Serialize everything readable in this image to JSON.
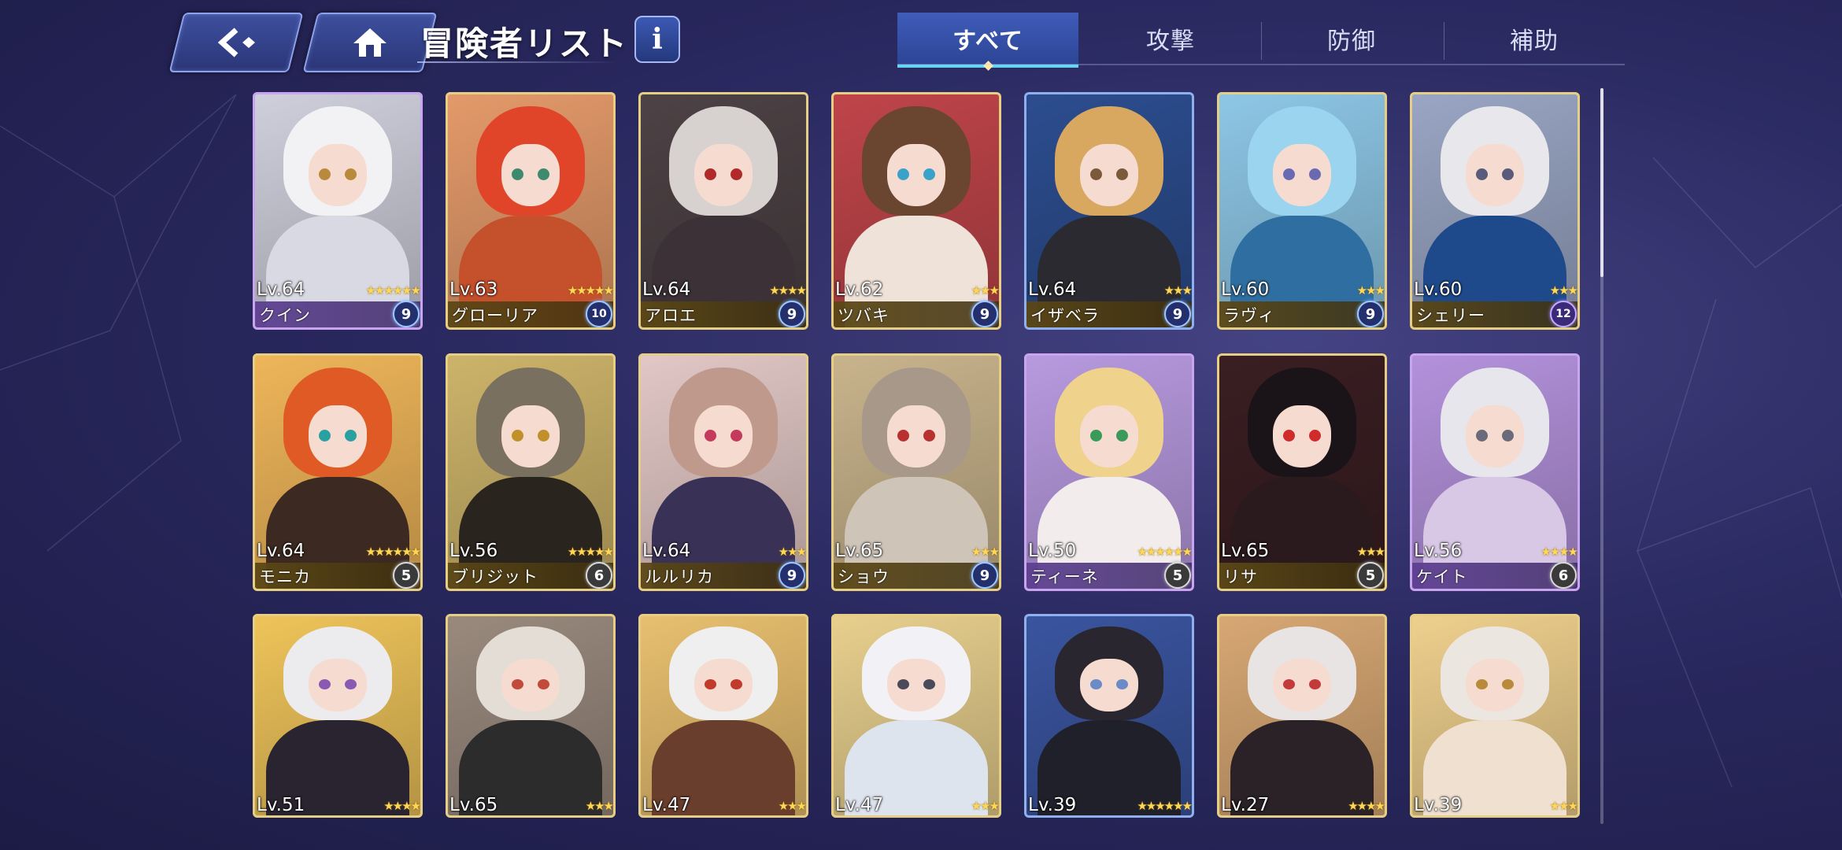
{
  "header": {
    "title": "冒険者リスト",
    "info_label": "i"
  },
  "tabs": [
    {
      "label": "すべて",
      "active": true
    },
    {
      "label": "攻撃",
      "active": false
    },
    {
      "label": "防御",
      "active": false
    },
    {
      "label": "補助",
      "active": false
    }
  ],
  "colors": {
    "tab_active": "#3f5cb9",
    "tab_underline": "#61d6f0",
    "frame_gold": "#e6cf84",
    "frame_purple": "#c9a5f0",
    "star": "#ffd658"
  },
  "rows": [
    [
      {
        "level": "Lv.64",
        "stars": "★★★★★★",
        "name": "クイン",
        "badge": "9",
        "badge_style": "blue",
        "rarity": "purple",
        "bg": "#cfd0dc",
        "hair": "#f2f2f4",
        "body": "#d9d9e4",
        "eye": "#b98a3c"
      },
      {
        "level": "Lv.63",
        "stars": "★★★★★",
        "name": "グローリア",
        "badge": "10",
        "badge_style": "blue",
        "rarity": "gold",
        "bg": "#e49a6a",
        "hair": "#e0452a",
        "body": "#c4502c",
        "eye": "#3e8a6e"
      },
      {
        "level": "Lv.64",
        "stars": "★★★★",
        "name": "アロエ",
        "badge": "9",
        "badge_style": "blue",
        "rarity": "gold",
        "bg": "#4d4245",
        "hair": "#d7d2cf",
        "body": "#3b3136",
        "eye": "#b02a2a"
      },
      {
        "level": "Lv.62",
        "stars": "★★★",
        "name": "ツバキ",
        "badge": "9",
        "badge_style": "blue",
        "rarity": "gold",
        "bg": "#c0454a",
        "hair": "#6a4530",
        "body": "#efe2d8",
        "eye": "#3aa2c8"
      },
      {
        "level": "Lv.64",
        "stars": "★★★",
        "name": "イザベラ",
        "badge": "9",
        "badge_style": "blue",
        "rarity": "blue",
        "bg": "#2c4d8f",
        "hair": "#d8a860",
        "body": "#2a2a30",
        "eye": "#7a5a3a"
      },
      {
        "level": "Lv.60",
        "stars": "★★★",
        "name": "ラヴィ",
        "badge": "9",
        "badge_style": "blue",
        "rarity": "gold",
        "bg": "#8ec7e6",
        "hair": "#9bd4ee",
        "body": "#2f6ea0",
        "eye": "#6a6ab2"
      },
      {
        "level": "Lv.60",
        "stars": "★★★",
        "name": "シェリー",
        "badge": "12",
        "badge_style": "purple",
        "rarity": "gold",
        "bg": "#9aa6c4",
        "hair": "#e8e8ec",
        "body": "#1e4a8c",
        "eye": "#5a5a7a"
      }
    ],
    [
      {
        "level": "Lv.64",
        "stars": "★★★★★★",
        "name": "モニカ",
        "badge": "5",
        "badge_style": "gray",
        "rarity": "gold",
        "bg": "#efb65a",
        "hair": "#e05a26",
        "body": "#3c2a22",
        "eye": "#2aa0a0"
      },
      {
        "level": "Lv.56",
        "stars": "★★★★★",
        "name": "ブリジット",
        "badge": "6",
        "badge_style": "gray",
        "rarity": "gold",
        "bg": "#cdb46a",
        "hair": "#7a7060",
        "body": "#2a241e",
        "eye": "#c2902a"
      },
      {
        "level": "Lv.64",
        "stars": "★★★",
        "name": "ルルリカ",
        "badge": "9",
        "badge_style": "blue",
        "rarity": "gold",
        "bg": "#e2c8c6",
        "hair": "#bf9a8c",
        "body": "#3a3256",
        "eye": "#c43a5a"
      },
      {
        "level": "Lv.65",
        "stars": "★★★",
        "name": "ショウ",
        "badge": "9",
        "badge_style": "blue",
        "rarity": "gold",
        "bg": "#c9b48c",
        "hair": "#a8988a",
        "body": "#cfc4b8",
        "eye": "#b83030"
      },
      {
        "level": "Lv.50",
        "stars": "★★★★★★",
        "name": "ティーネ",
        "badge": "5",
        "badge_style": "gray",
        "rarity": "purple",
        "bg": "#b89ae0",
        "hair": "#efd28c",
        "body": "#f2ecec",
        "eye": "#3a9a5a"
      },
      {
        "level": "Lv.65",
        "stars": "★★★",
        "name": "リサ",
        "badge": "5",
        "badge_style": "gray",
        "rarity": "gold",
        "bg": "#3a1e22",
        "hair": "#1a1418",
        "body": "#2a1a1e",
        "eye": "#d02a2a"
      },
      {
        "level": "Lv.56",
        "stars": "★★★★",
        "name": "ケイト",
        "badge": "6",
        "badge_style": "gray",
        "rarity": "purple",
        "bg": "#b492dc",
        "hair": "#e6e6ec",
        "body": "#d8c8e6",
        "eye": "#6a6a7a"
      }
    ],
    [
      {
        "level": "Lv.51",
        "stars": "★★★★",
        "rarity": "gold",
        "bg": "#efc45a",
        "hair": "#ecebee",
        "body": "#2a2430",
        "eye": "#8a5ab2"
      },
      {
        "level": "Lv.65",
        "stars": "★★★",
        "rarity": "gold",
        "bg": "#9a8a7e",
        "hair": "#e4ddd6",
        "body": "#2c2c2c",
        "eye": "#c24a3a"
      },
      {
        "level": "Lv.47",
        "stars": "★★★",
        "rarity": "gold",
        "bg": "#e9c070",
        "hair": "#efefef",
        "body": "#6a3e2c",
        "eye": "#c23a2a"
      },
      {
        "level": "Lv.47",
        "stars": "★★★",
        "rarity": "gold",
        "bg": "#e8d08e",
        "hair": "#f2f2f6",
        "body": "#dde4ee",
        "eye": "#4a4a5a"
      },
      {
        "level": "Lv.39",
        "stars": "★★★★★★",
        "rarity": "blue",
        "bg": "#3a55a0",
        "hair": "#2a2630",
        "body": "#20202a",
        "eye": "#6a8ac8"
      },
      {
        "level": "Lv.27",
        "stars": "★★★★",
        "rarity": "gold",
        "bg": "#d8a874",
        "hair": "#e8e4e4",
        "body": "#2a2226",
        "eye": "#c23a3a"
      },
      {
        "level": "Lv.39",
        "stars": "★★★",
        "rarity": "gold",
        "bg": "#efd08e",
        "hair": "#ece6e0",
        "body": "#f0e0d0",
        "eye": "#b88a3a"
      }
    ]
  ]
}
